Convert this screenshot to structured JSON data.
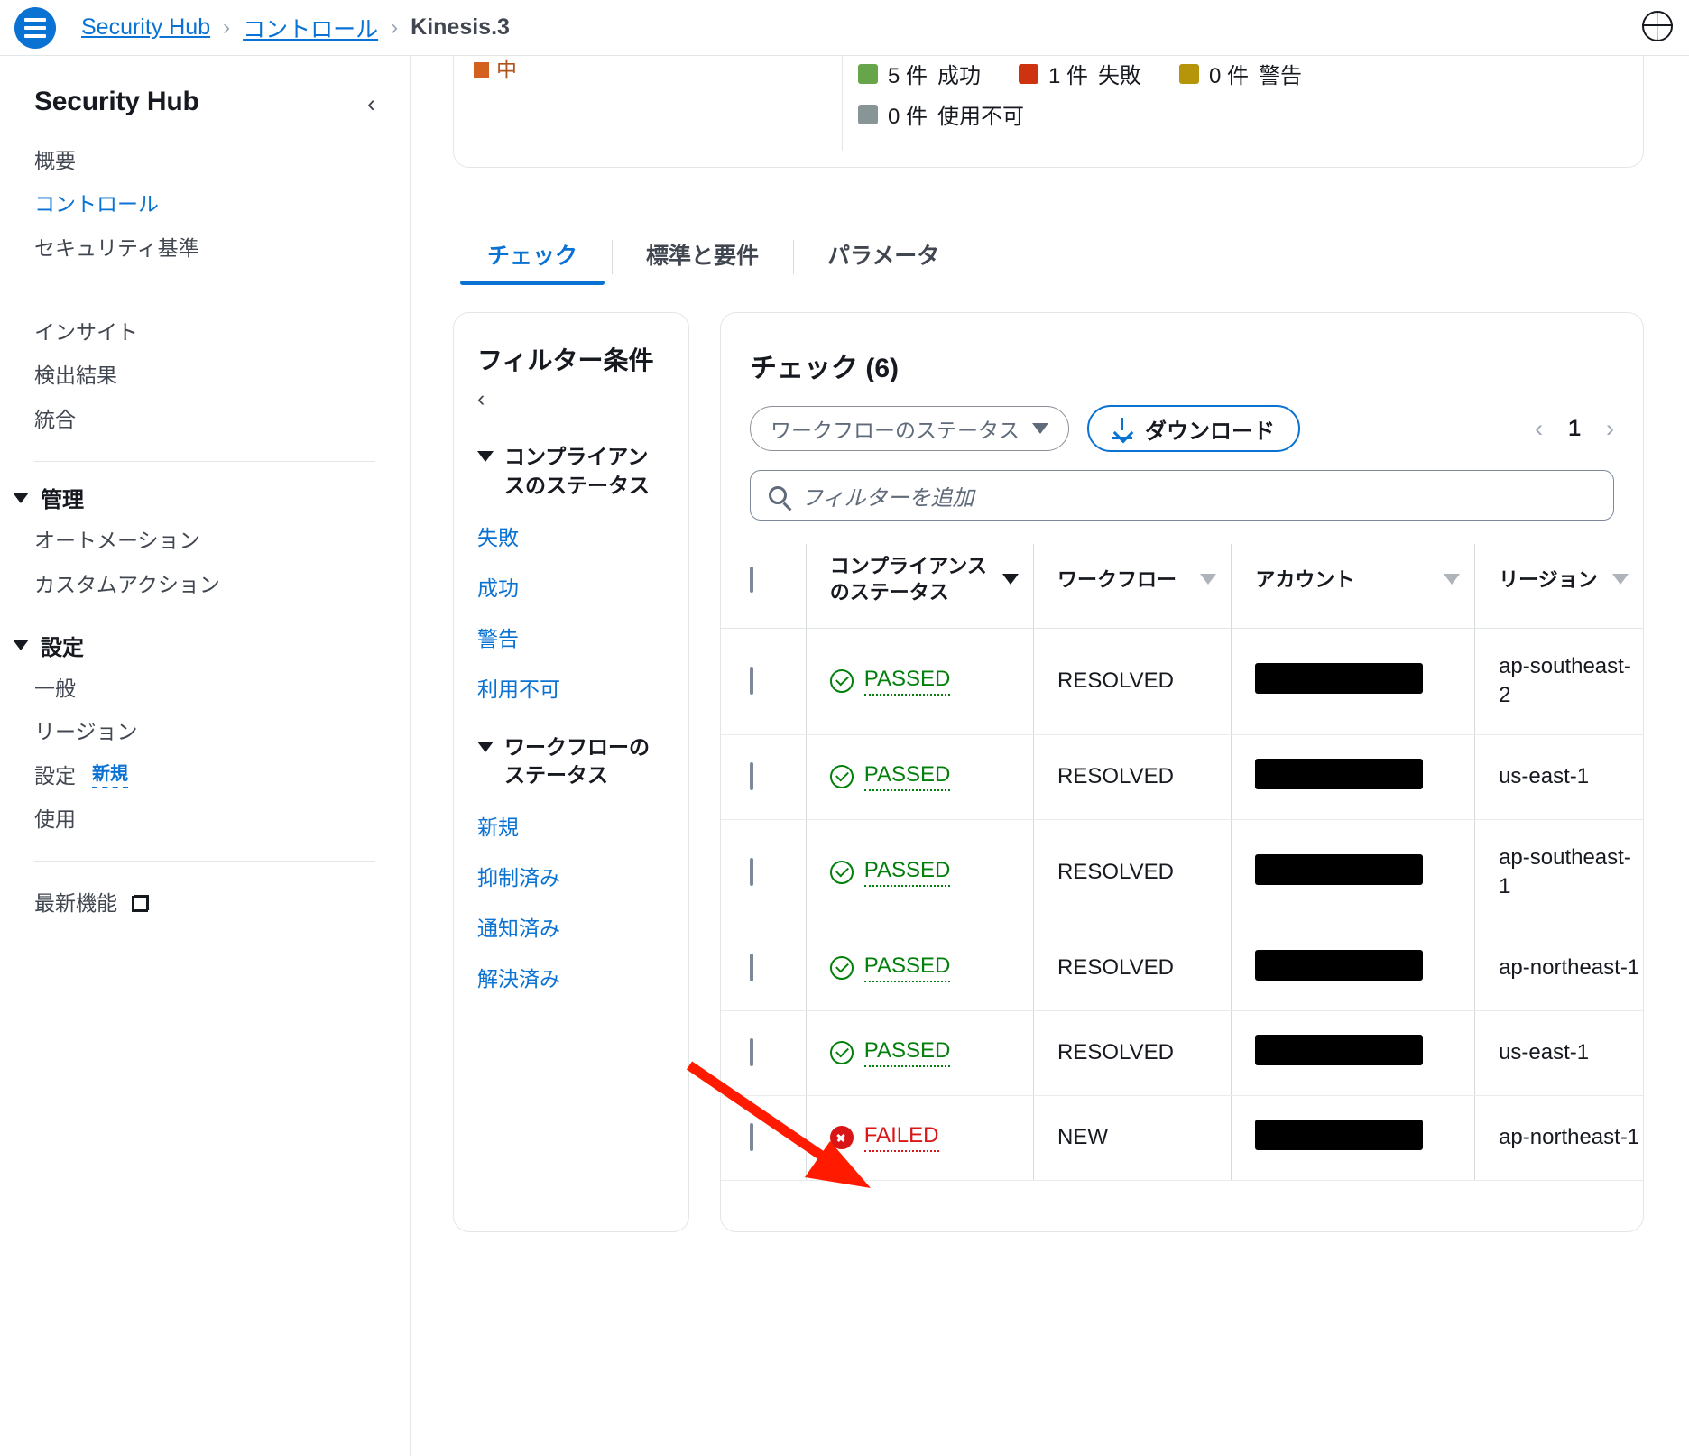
{
  "topbar": {
    "menu_icon": "hamburger-icon",
    "globe_icon": "globe-icon",
    "breadcrumb": [
      {
        "label": "Security Hub",
        "current": false
      },
      {
        "label": "コントロール",
        "current": false
      },
      {
        "label": "Kinesis.3",
        "current": true
      }
    ],
    "separator": "›"
  },
  "sidebar": {
    "title": "Security Hub",
    "collapse_icon": "chevron-left-icon",
    "collapse_glyph": "‹",
    "items_top": [
      {
        "label": "概要",
        "active": false
      },
      {
        "label": "コントロール",
        "active": true
      },
      {
        "label": "セキュリティ基準",
        "active": false
      }
    ],
    "items_mid": [
      {
        "label": "インサイト"
      },
      {
        "label": "検出結果"
      },
      {
        "label": "統合"
      }
    ],
    "group_admin": {
      "label": "管理",
      "items": [
        {
          "label": "オートメーション"
        },
        {
          "label": "カスタムアクション"
        }
      ]
    },
    "group_settings": {
      "label": "設定",
      "items": [
        {
          "label": "一般",
          "badge": ""
        },
        {
          "label": "リージョン",
          "badge": ""
        },
        {
          "label": "設定",
          "badge": "新規"
        },
        {
          "label": "使用",
          "badge": ""
        }
      ]
    },
    "footer_link": {
      "label": "最新機能",
      "icon": "external-link-icon"
    }
  },
  "legend": {
    "severity_chip": {
      "label": "中",
      "color": "#d4601f"
    },
    "rows": [
      [
        {
          "count": "5 件",
          "label": "成功",
          "color": "#67a54b"
        },
        {
          "count": "1 件",
          "label": "失敗",
          "color": "#ce3311"
        },
        {
          "count": "0 件",
          "label": "警告",
          "color": "#b7950b"
        }
      ],
      [
        {
          "count": "0 件",
          "label": "使用不可",
          "color": "#879596"
        }
      ]
    ]
  },
  "tabs": [
    {
      "label": "チェック",
      "active": true
    },
    {
      "label": "標準と要件",
      "active": false
    },
    {
      "label": "パラメータ",
      "active": false
    }
  ],
  "filter_panel": {
    "title": "フィルター条件",
    "collapse_icon": "chevron-left-icon",
    "collapse_glyph": "‹",
    "groups": [
      {
        "label": "コンプライアンスのステータス",
        "links": [
          "失敗",
          "成功",
          "警告",
          "利用不可"
        ]
      },
      {
        "label": "ワークフローのステータス",
        "links": [
          "新規",
          "抑制済み",
          "通知済み",
          "解決済み"
        ]
      }
    ]
  },
  "checks_table": {
    "title": "チェック (6)",
    "workflow_select": {
      "label": "ワークフローのステータス",
      "icon": "chevron-down-icon"
    },
    "download_button": {
      "label": "ダウンロード",
      "icon": "download-icon"
    },
    "pagination": {
      "prev_icon": "chevron-left-icon",
      "prev_glyph": "‹",
      "page": "1",
      "next_icon": "chevron-right-icon",
      "next_glyph": "›"
    },
    "search": {
      "placeholder": "フィルターを追加",
      "icon": "search-icon",
      "value": ""
    },
    "columns": [
      {
        "key": "checkbox",
        "label": "",
        "sort": "none"
      },
      {
        "key": "compliance",
        "label": "コンプライアンスのステータス",
        "sort": "active"
      },
      {
        "key": "workflow",
        "label": "ワークフロー",
        "sort": "inactive"
      },
      {
        "key": "account",
        "label": "アカウント",
        "sort": "inactive"
      },
      {
        "key": "region",
        "label": "リージョン",
        "sort": "inactive"
      }
    ],
    "rows": [
      {
        "status": "PASSED",
        "status_type": "pass",
        "workflow": "RESOLVED",
        "account": "[redacted]",
        "region": "ap-southeast-2"
      },
      {
        "status": "PASSED",
        "status_type": "pass",
        "workflow": "RESOLVED",
        "account": "[redacted]",
        "region": "us-east-1"
      },
      {
        "status": "PASSED",
        "status_type": "pass",
        "workflow": "RESOLVED",
        "account": "[redacted]",
        "region": "ap-southeast-1"
      },
      {
        "status": "PASSED",
        "status_type": "pass",
        "workflow": "RESOLVED",
        "account": "[redacted]",
        "region": "ap-northeast-1"
      },
      {
        "status": "PASSED",
        "status_type": "pass",
        "workflow": "RESOLVED",
        "account": "[redacted]",
        "region": "us-east-1"
      },
      {
        "status": "FAILED",
        "status_type": "fail",
        "workflow": "NEW",
        "account": "[redacted]",
        "region": "ap-northeast-1"
      }
    ]
  },
  "annotation": {
    "type": "arrow",
    "color": "#ff1a00",
    "points_to": "failed-row"
  },
  "colors": {
    "link": "#0972d3",
    "pass": "#037f0c",
    "fail": "#d91515",
    "border": "#e3e6e8"
  }
}
